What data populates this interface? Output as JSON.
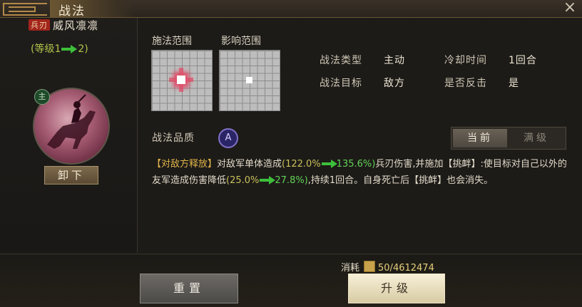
{
  "window": {
    "title": "战法",
    "close_icon": "×"
  },
  "skill": {
    "tag": "兵刃",
    "name": "威风凛凛",
    "level_prefix": "(等级1",
    "level_suffix": "2)",
    "master_badge": "主",
    "unequip_label": "卸下"
  },
  "ranges": {
    "cast_label": "施法范围",
    "effect_label": "影响范围"
  },
  "info": {
    "type_label": "战法类型",
    "type_value": "主动",
    "target_label": "战法目标",
    "target_value": "敌方",
    "cooldown_label": "冷却时间",
    "cooldown_value": "1回合",
    "counter_label": "是否反击",
    "counter_value": "是"
  },
  "quality": {
    "label": "战法品质",
    "grade": "A"
  },
  "toggle": {
    "current": "当前",
    "max": "满级"
  },
  "description": {
    "p1_tag": "【对敌方释放】",
    "p2": "对敌军单体造成",
    "p3_open": "(122.0%",
    "p4_close": "135.6%)",
    "p5": "兵刃伤害,并施加【挑衅】:使目标对自己以外的友军造成伤害降低",
    "p6_open": "(25.0%",
    "p7_close": "27.8%)",
    "p8": ",持续1回合。自身死亡后【挑衅】也会消失。"
  },
  "footer": {
    "cost_label": "消耗",
    "cost_value": "50/4612474",
    "reset_label": "重置",
    "upgrade_label": "升级"
  }
}
